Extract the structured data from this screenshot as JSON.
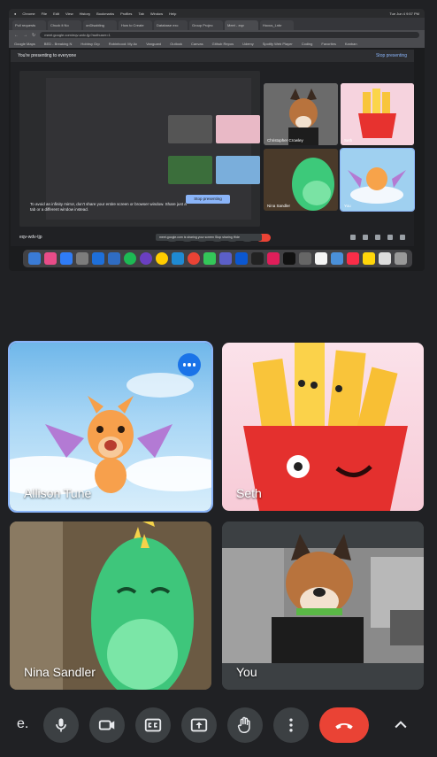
{
  "shared_screen": {
    "menubar": {
      "left": [
        "Chrome",
        "File",
        "Edit",
        "View",
        "History",
        "Bookmarks",
        "Profiles",
        "Tab",
        "Window",
        "Help"
      ],
      "right": "Tue Jun 4 9:57 PM"
    },
    "tabs": [
      "Pull requests",
      "Chuck it No",
      "onDisabling",
      "How to Create",
      "Database exc",
      "Group Projec",
      "Meet - eqv",
      "Hocus_Lnbr"
    ],
    "omnibox": "meet.google.com/eqv-wdv-tjp?authuser=1",
    "bookmarks": [
      "Google Maps",
      "BED - Breaking N",
      "Hobbsy Grp",
      "Robinhood: My Ac",
      "Vanguard",
      "Outlook",
      "Canvas",
      "Github Repos",
      "Udemy",
      "Spotify Web Player",
      "Coding",
      "Favorites",
      "Kanban"
    ],
    "presenting_banner": "You're presenting to everyone",
    "stop_presenting_link": "Stop presenting",
    "infinity_warning": "To avoid an infinity mirror, don't share your entire screen or browser window. Share just a tab or a different window instead.",
    "stop_presenting_button": "Stop presenting",
    "meeting_code_small": "eqv-wdv-tjp",
    "toast_small": "meet.google.com is sharing your screen",
    "toast_small_stop": "Stop sharing",
    "toast_small_hide": "Hide",
    "mini_tiles": [
      {
        "name": "Christopher Crowley",
        "bg": "#6b6b6b"
      },
      {
        "name": "Seth",
        "bg": "#f6d3de"
      },
      {
        "name": "Nina Sandler",
        "bg": "#4a3a2a"
      },
      {
        "name": "You",
        "bg": "#9fd0f0"
      }
    ]
  },
  "participants": [
    {
      "name": "Allison Tune",
      "avatar": "purple-winged-dragon-icon"
    },
    {
      "name": "Seth",
      "avatar": "french-fries-icon"
    },
    {
      "name": "Nina Sandler",
      "avatar": "green-dinosaur-icon"
    },
    {
      "name": "You",
      "avatar": "dog-filter-icon"
    }
  ],
  "controls": {
    "meeting_code": "e.",
    "buttons": [
      "microphone",
      "camera",
      "captions",
      "present-screen",
      "raise-hand",
      "more-options",
      "end-call"
    ]
  },
  "colors": {
    "background": "#202124",
    "control_bg": "#3c4043",
    "end_call": "#ea4335",
    "accent": "#8ab4f8",
    "more_button": "#1a73e8"
  }
}
